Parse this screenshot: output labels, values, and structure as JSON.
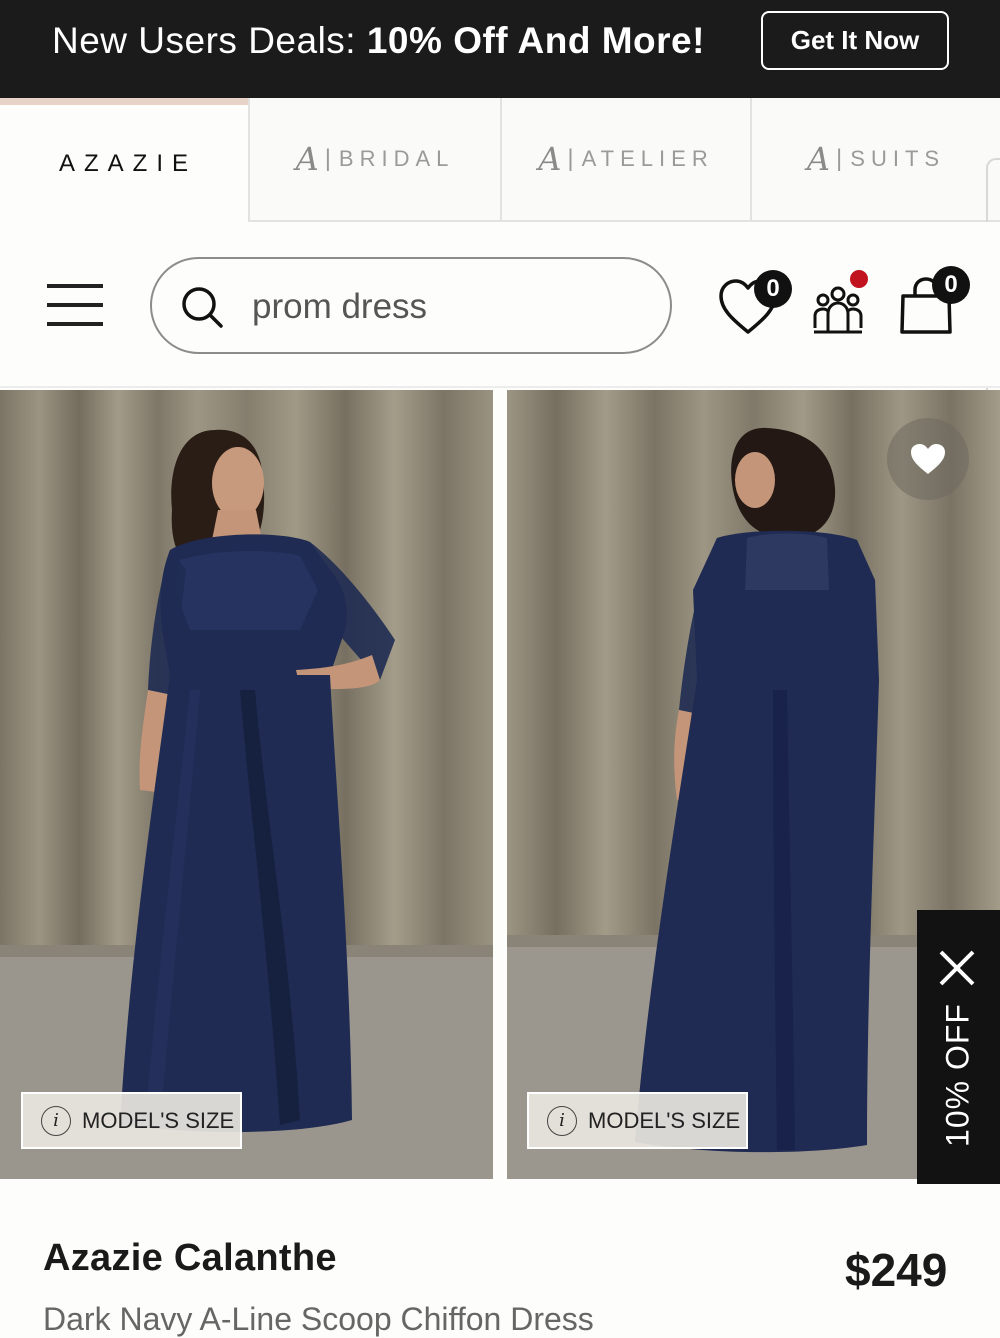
{
  "promo": {
    "text_regular": "New Users Deals: ",
    "text_bold": "10% Off And More!",
    "button_label": "Get It Now"
  },
  "brand_tabs": {
    "main": "AZAZIE",
    "bridal": "BRIDAL",
    "atelier": "ATELIER",
    "suits": "SUITS",
    "logo_letter": "A",
    "separator": "|"
  },
  "header": {
    "search_value": "prom dress",
    "wishlist_count": "0",
    "cart_count": "0"
  },
  "photos": [
    {
      "size_label": "MODEL'S SIZE",
      "info_glyph": "i"
    },
    {
      "size_label": "MODEL'S SIZE",
      "info_glyph": "i"
    }
  ],
  "side_offer": {
    "label": "10% OFF"
  },
  "product": {
    "name": "Azazie Calanthe",
    "price": "$249",
    "description": "Dark Navy A-Line Scoop Chiffon Dress"
  },
  "colors": {
    "banner_bg": "#1b1b1b",
    "dress_navy": "#1f2b52",
    "tab_accent": "#e7d3c8",
    "notification_red": "#c0121f"
  },
  "icons": [
    "menu-icon",
    "search-icon",
    "heart-icon",
    "community-icon",
    "cart-bag-icon",
    "info-icon",
    "close-icon"
  ]
}
